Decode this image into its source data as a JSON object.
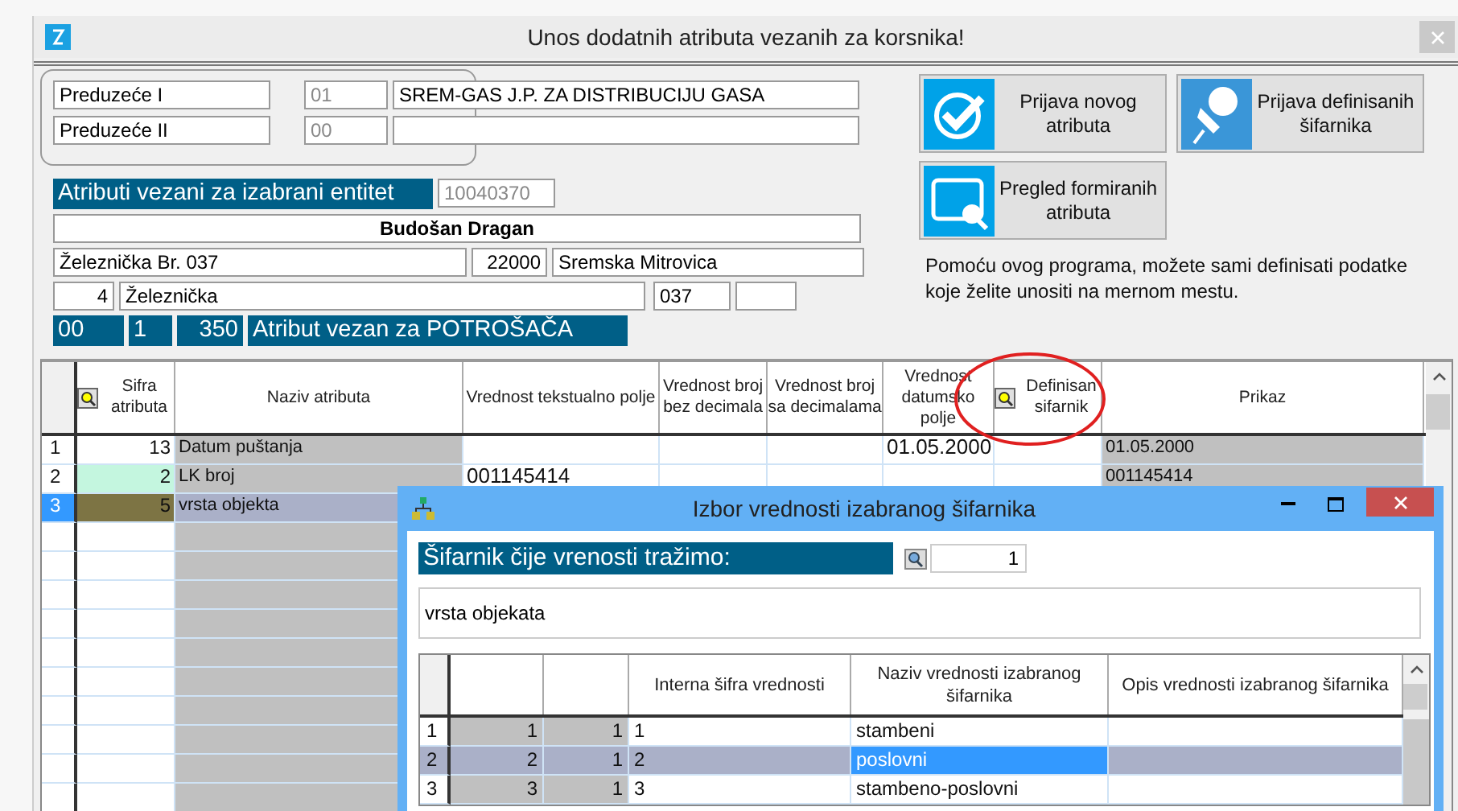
{
  "window": {
    "title": "Unos dodatnih atributa vezanih za korsnika!"
  },
  "companies": [
    {
      "label": "Preduzeće I",
      "code": "01",
      "name": "SREM-GAS J.P. ZA DISTRIBUCIJU GASA"
    },
    {
      "label": "Preduzeće II",
      "code": "00"
    }
  ],
  "entity": {
    "label": "Atributi vezani za izabrani entitet",
    "id": "10040370",
    "person": "Budošan Dragan",
    "street_full": "Železnička Br. 037",
    "postal_code": "22000",
    "city": "Sremska Mitrovica",
    "street_code": "4",
    "street": "Železnička",
    "house_number": "037"
  },
  "attribute_group": {
    "code_1": "00",
    "code_2": "1",
    "code_3": "350",
    "label": "Atribut vezan za POTROŠAČA"
  },
  "actions": [
    {
      "label": "Prijava novog atributa",
      "kind": "check"
    },
    {
      "label": "Prijava definisanih šifarnika",
      "kind": "pin"
    },
    {
      "label": "Pregled formiranih atributa",
      "kind": "preview"
    }
  ],
  "description": "Pomoću ovog programa, možete sami definisati podatke koje želite unositi na mernom mestu.",
  "table": {
    "columns": [
      {
        "label": "Sifra atributa",
        "search": true
      },
      {
        "label": "Naziv atributa",
        "search": false
      },
      {
        "label": "Vrednost tekstualno polje",
        "search": false
      },
      {
        "label": "Vrednost broj bez decimala",
        "search": false
      },
      {
        "label": "Vrednost broj sa decimalama",
        "search": false
      },
      {
        "label": "Vrednost datumsko polje",
        "search": false
      },
      {
        "label": "Definisan sifarnik",
        "search": true
      },
      {
        "label": "Prikaz",
        "search": false
      }
    ],
    "rows": [
      {
        "number": "1",
        "selected": false,
        "color": "#ffffff",
        "code": "13",
        "name": "Datum puštanja",
        "date_value": "01.05.2000",
        "display": "01.05.2000"
      },
      {
        "number": "2",
        "selected": false,
        "color": "#c4f6df",
        "code": "2",
        "name": "LK broj",
        "text_value": "001145414",
        "display": "001145414"
      },
      {
        "number": "3",
        "selected": true,
        "color": "#7d7444",
        "code": "5",
        "name": "vrsta objekta"
      }
    ]
  },
  "dialog": {
    "title": "Izbor vrednosti izabranog šifarnika",
    "label": "Šifarnik čije vrenosti tražimo:",
    "search_value": "1",
    "codebook": "vrsta objekata",
    "columns": [
      "Interna šifra vrednosti",
      "Naziv vrednosti izabranog šifarnika",
      "Opis vrednosti izabranog šifarnika"
    ],
    "rows": [
      {
        "number": "1",
        "selected": false,
        "column_1": "1",
        "column_2": "1",
        "internal": "1",
        "name": "stambeni"
      },
      {
        "number": "2",
        "selected": true,
        "column_1": "2",
        "column_2": "1",
        "internal": "2",
        "name": "poslovni"
      },
      {
        "number": "3",
        "selected": false,
        "column_1": "3",
        "column_2": "1",
        "internal": "3",
        "name": "stambeno-poslovni"
      }
    ]
  }
}
